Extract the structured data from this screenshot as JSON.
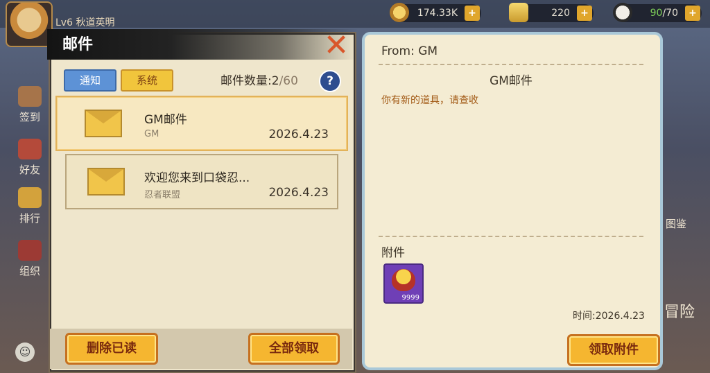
{
  "topbar": {
    "level": "Lv6",
    "player_name": "秋道英明",
    "coins": "174.33K",
    "gold": "220",
    "stamina_current": "90",
    "stamina_max": "/70",
    "plus": "+"
  },
  "sidenav": [
    "签到",
    "好友",
    "排行",
    "组织"
  ],
  "rside": [
    "图鉴",
    "冒险"
  ],
  "mail_panel": {
    "title": "邮件",
    "close": "✕",
    "tabs": [
      "通知",
      "系统"
    ],
    "count_label": "邮件数量:",
    "count_current": "2",
    "count_max": "/60",
    "help": "?",
    "items": [
      {
        "subject": "GM邮件",
        "sender": "GM",
        "date": "2026.4.23"
      },
      {
        "subject": "欢迎您来到口袋忍...",
        "sender": "忍者联盟",
        "date": "2026.4.23"
      }
    ],
    "delete_read": "删除已读",
    "claim_all": "全部领取"
  },
  "detail": {
    "from": "From: GM",
    "subject": "GM邮件",
    "body": "你有新的道具，请查收",
    "attachments_label": "附件",
    "attachment_qty": "9999",
    "time": "时间:2026.4.23",
    "claim_button": "领取附件"
  },
  "colors": {
    "accent_gold": "#f5b630",
    "tab_blue": "#5d92d6",
    "body_text_orange": "#a25a16"
  }
}
